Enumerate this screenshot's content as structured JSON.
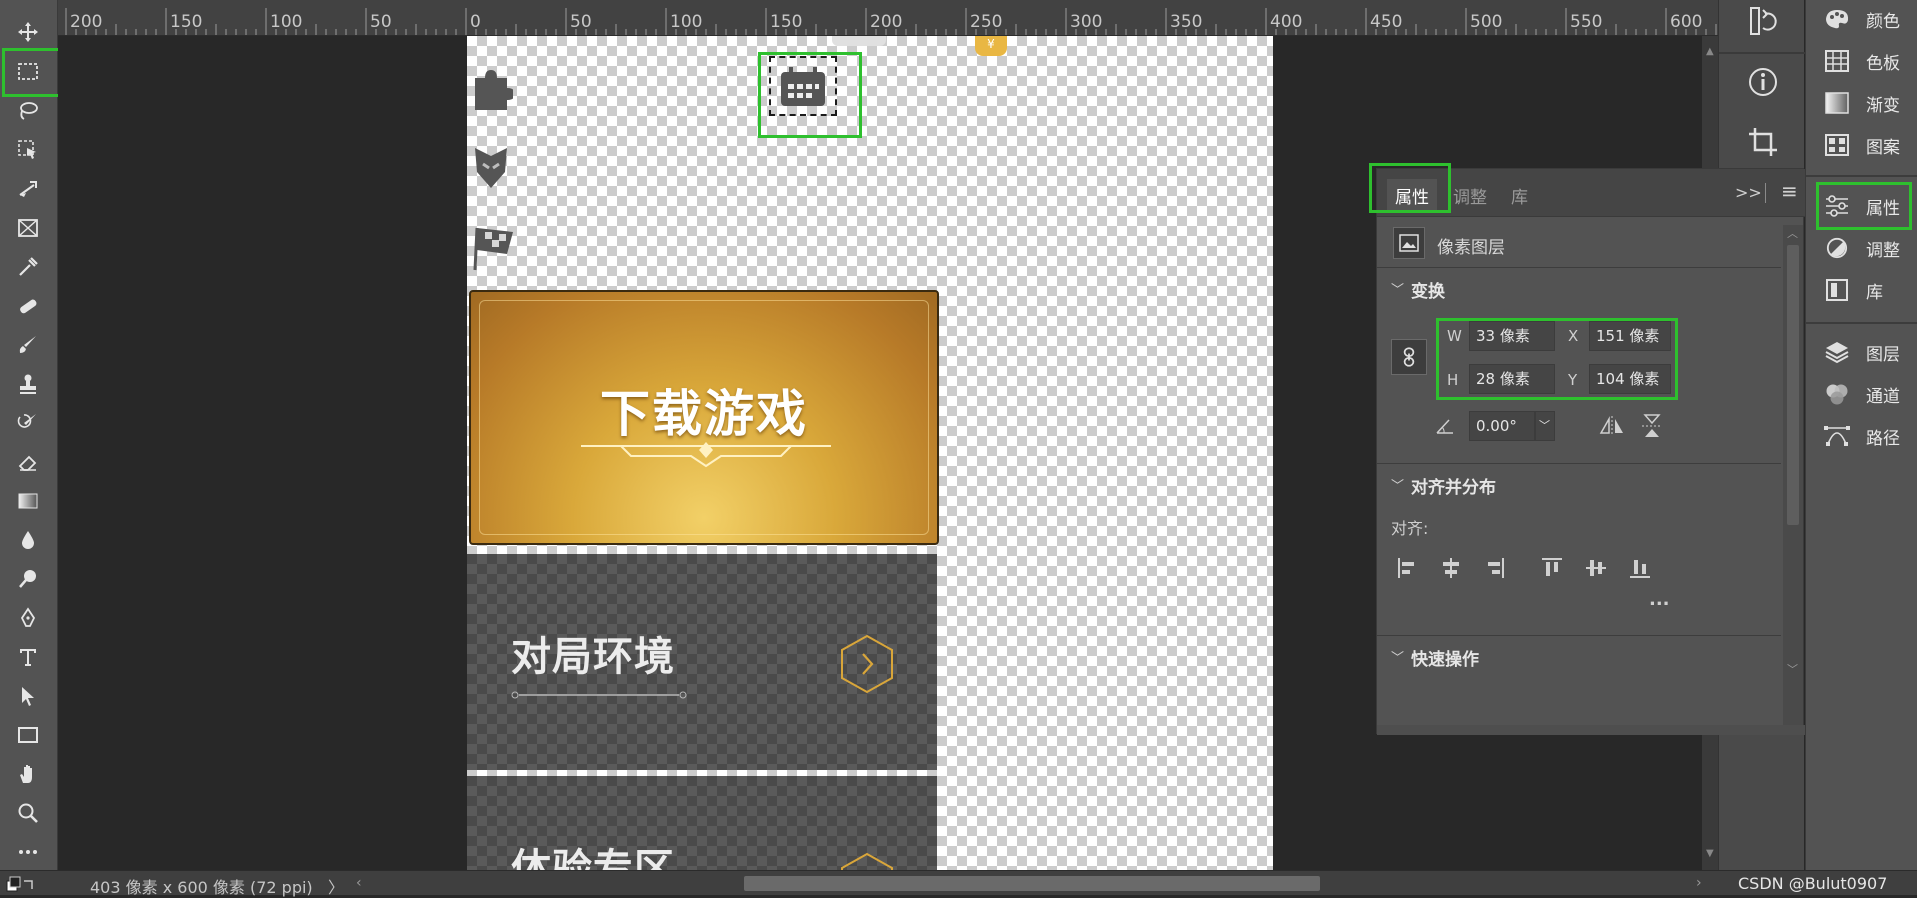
{
  "ruler": {
    "labels": [
      "200",
      "150",
      "100",
      "50",
      "0",
      "50",
      "100",
      "150",
      "200",
      "250",
      "300",
      "350",
      "400",
      "450",
      "500",
      "550",
      "600"
    ]
  },
  "canvas": {
    "gold_card_title": "下载游戏",
    "card1_title": "对局环境",
    "card2_title": "体验专区",
    "coin_badge": "¥"
  },
  "properties_panel": {
    "tabs": [
      "属性",
      "调整",
      "库"
    ],
    "layer_type": "像素图层",
    "transform_header": "变换",
    "w_label": "W",
    "w_value": "33 像素",
    "h_label": "H",
    "h_value": "28 像素",
    "x_label": "X",
    "x_value": "151 像素",
    "y_label": "Y",
    "y_value": "104 像素",
    "angle_value": "0.00°",
    "align_header": "对齐并分布",
    "align_label": "对齐:",
    "more_label": "...",
    "quick_actions_header": "快速操作",
    "expand_glyph": ">>",
    "menu_glyph": "≡"
  },
  "right_panel": {
    "items": [
      {
        "label": "颜色",
        "icon": "palette-icon"
      },
      {
        "label": "色板",
        "icon": "swatches-icon"
      },
      {
        "label": "渐变",
        "icon": "gradient-icon"
      },
      {
        "label": "图案",
        "icon": "pattern-icon"
      },
      {
        "label": "属性",
        "icon": "properties-icon"
      },
      {
        "label": "调整",
        "icon": "adjustments-icon"
      },
      {
        "label": "库",
        "icon": "libraries-icon"
      },
      {
        "label": "图层",
        "icon": "layers-icon"
      },
      {
        "label": "通道",
        "icon": "channels-icon"
      },
      {
        "label": "路径",
        "icon": "paths-icon"
      }
    ]
  },
  "status_bar": {
    "doc_info": "403 像素 x 600 像素 (72 ppi)",
    "arrow": "〉",
    "watermark": "CSDN @Bulut0907"
  },
  "colors": {
    "highlight": "#2ec02e",
    "panel_bg": "#535353",
    "workspace_bg": "#282828"
  }
}
